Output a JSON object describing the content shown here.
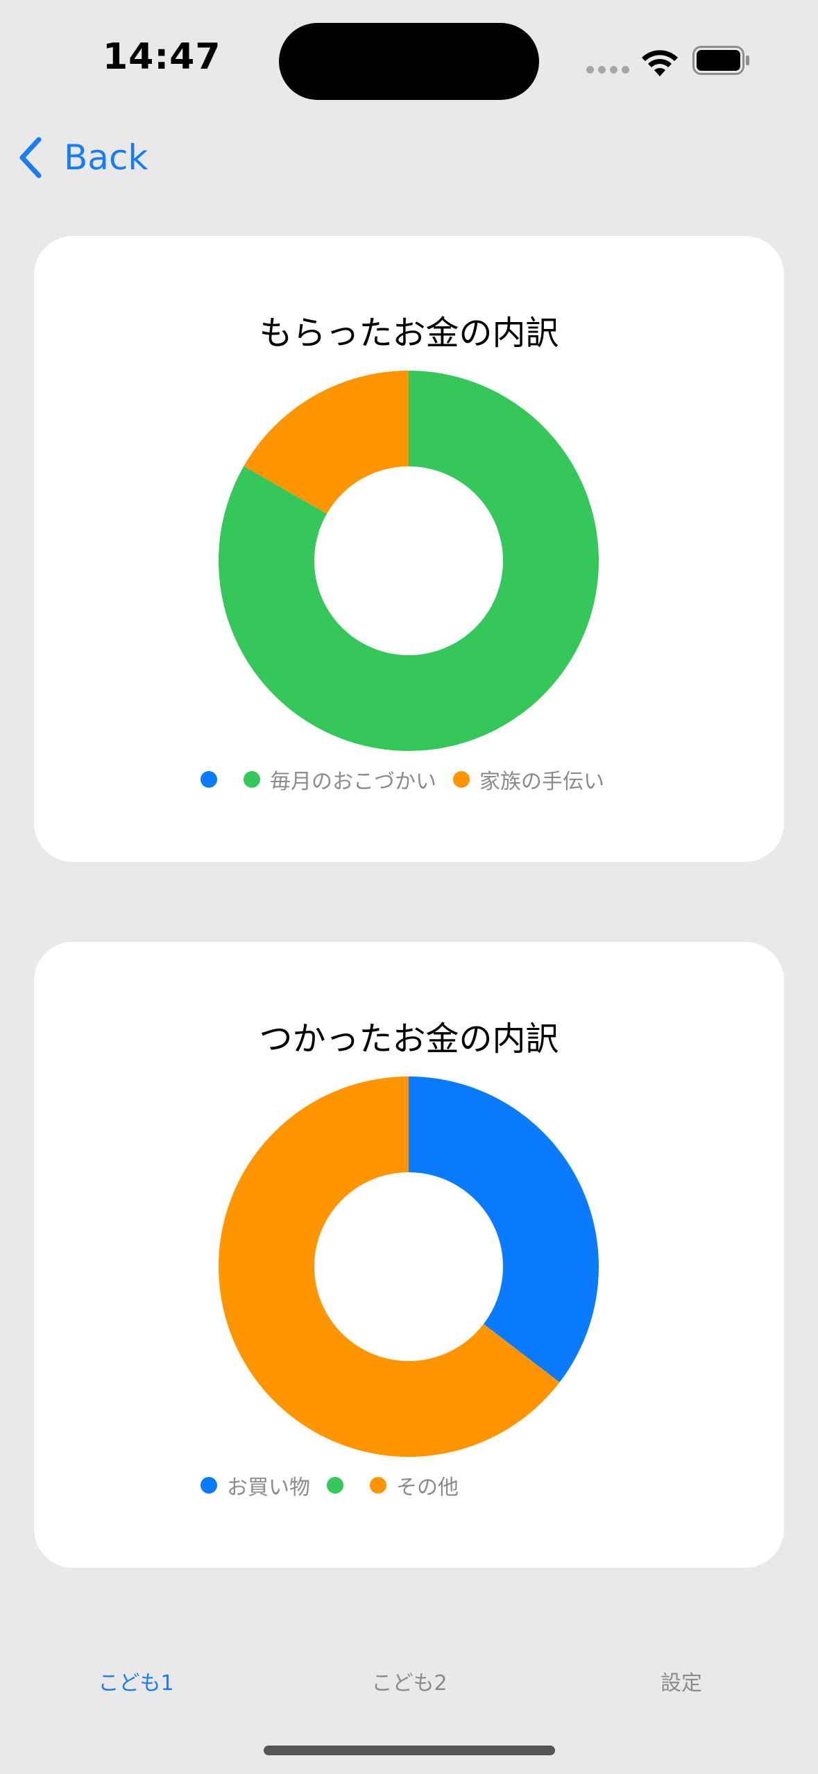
{
  "status_bar": {
    "time": "14:47"
  },
  "nav": {
    "back_label": "Back",
    "accent_color": "#1a7cf5"
  },
  "charts": [
    {
      "title": "もらったお金の内訳"
    },
    {
      "title": "つかったお金の内訳"
    }
  ],
  "chart_data": [
    {
      "type": "pie",
      "title": "もらったお金の内訳",
      "donut": true,
      "legend_position": "bottom",
      "series": [
        {
          "name": "",
          "value": 0,
          "color": "#0a7aff"
        },
        {
          "name": "毎月のおこづかい",
          "value": 83.3,
          "color": "#35c759"
        },
        {
          "name": "家族の手伝い",
          "value": 16.7,
          "color": "#ff9500"
        }
      ]
    },
    {
      "type": "pie",
      "title": "つかったお金の内訳",
      "donut": true,
      "legend_position": "bottom",
      "series": [
        {
          "name": "お買い物",
          "value": 35.4,
          "color": "#0a7aff"
        },
        {
          "name": "",
          "value": 0,
          "color": "#35c759"
        },
        {
          "name": "その他",
          "value": 64.6,
          "color": "#ff9500"
        }
      ]
    }
  ],
  "tabs": [
    {
      "label": "こども1",
      "active": true
    },
    {
      "label": "こども2",
      "active": false
    },
    {
      "label": "設定",
      "active": false
    }
  ]
}
